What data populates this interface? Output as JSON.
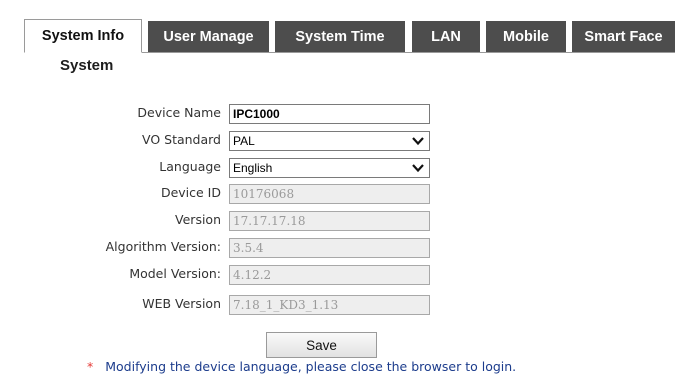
{
  "tabs": [
    {
      "label": "System Info",
      "active": true
    },
    {
      "label": "User Manage",
      "active": false
    },
    {
      "label": "System Time",
      "active": false
    },
    {
      "label": "LAN",
      "active": false
    },
    {
      "label": "Mobile",
      "active": false
    },
    {
      "label": "Smart Face",
      "active": false
    }
  ],
  "section_title": "System",
  "fields": {
    "device_name": {
      "label": "Device Name",
      "value": "IPC1000"
    },
    "vo_standard": {
      "label": "VO Standard",
      "value": "PAL"
    },
    "language": {
      "label": "Language",
      "value": "English"
    },
    "device_id": {
      "label": "Device ID",
      "value": "10176068"
    },
    "version": {
      "label": "Version",
      "value": "17.17.17.18"
    },
    "algorithm_version": {
      "label": "Algorithm Version:",
      "value": "3.5.4"
    },
    "model_version": {
      "label": "Model Version:",
      "value": "4.12.2"
    },
    "web_version": {
      "label": "WEB Version",
      "value": "7.18_1_KD3_1.13"
    }
  },
  "save_label": "Save",
  "note": {
    "marker": "*",
    "text": "Modifying the device language, please close the browser to login."
  },
  "colors": {
    "tab_inactive_bg": "#4d4d4d",
    "note_text": "#1c3c8c",
    "note_marker": "#e53935"
  }
}
